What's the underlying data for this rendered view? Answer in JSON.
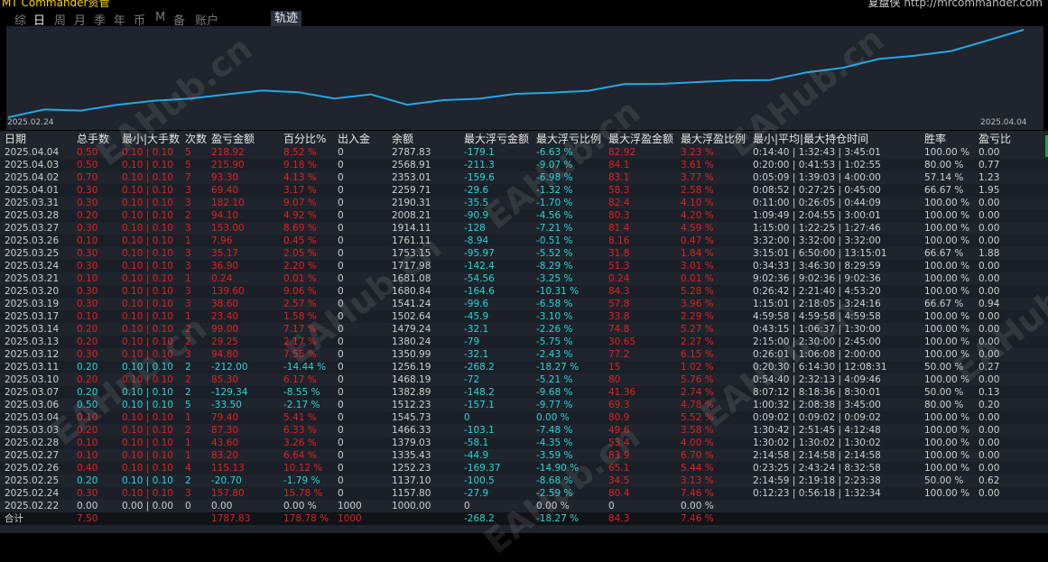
{
  "header": {
    "brand": "MT Commander资管",
    "credit_label": "复盘侠",
    "credit_url": "http://mrcommander.com"
  },
  "tabs": [
    {
      "label": "综",
      "active": false
    },
    {
      "label": "日",
      "active": true
    },
    {
      "label": "周",
      "active": false
    },
    {
      "label": "月",
      "active": false
    },
    {
      "label": "季",
      "active": false
    },
    {
      "label": "年",
      "active": false
    },
    {
      "label": "币",
      "active": false
    },
    {
      "label": "M",
      "active": false
    },
    {
      "label": "备",
      "active": false
    },
    {
      "label": "账户",
      "active": false
    }
  ],
  "view_button": "轨迹",
  "watermark_text": "EAHub.cn",
  "chart_data": {
    "type": "line",
    "x_start_label": "2025.02.24",
    "x_end_label": "2025.04.04",
    "x": [
      "2025.02.24",
      "2025.02.25",
      "2025.02.26",
      "2025.02.27",
      "2025.02.28",
      "2025.03.03",
      "2025.03.04",
      "2025.03.06",
      "2025.03.07",
      "2025.03.10",
      "2025.03.11",
      "2025.03.12",
      "2025.03.13",
      "2025.03.14",
      "2025.03.17",
      "2025.03.19",
      "2025.03.20",
      "2025.03.21",
      "2025.03.24",
      "2025.03.25",
      "2025.03.26",
      "2025.03.27",
      "2025.03.28",
      "2025.03.31",
      "2025.04.01",
      "2025.04.02",
      "2025.04.03",
      "2025.04.04"
    ],
    "values": [
      1000.0,
      1157.8,
      1137.1,
      1252.23,
      1335.43,
      1379.03,
      1466.33,
      1545.73,
      1512.23,
      1382.89,
      1468.19,
      1256.19,
      1350.99,
      1380.24,
      1479.24,
      1502.64,
      1541.24,
      1680.84,
      1681.08,
      1717.98,
      1753.15,
      1761.11,
      1914.11,
      2008.21,
      2190.31,
      2259.71,
      2353.01,
      2568.91,
      2787.83
    ],
    "color": "#23a8e6",
    "grid": false
  },
  "table": {
    "columns": [
      "日期",
      "总手数",
      "最小|大手数",
      "次数",
      "盈亏金额",
      "百分比%",
      "出入金",
      "余额",
      "最大浮亏金额",
      "最大浮亏比例",
      "最大浮盈金额",
      "最大浮盈比例",
      "最小|平均|最大持仓时间",
      "胜率",
      "盈亏比"
    ],
    "rows": [
      {
        "tone": "red",
        "cells": [
          "2025.04.04",
          "0.50",
          "0.10 | 0.10",
          "5",
          "218.92",
          "8.52 %",
          "0",
          "2787.83",
          "-179.1",
          "-6.63 %",
          "82.92",
          "3.23 %",
          "0:14:40 | 1:32:43 | 3:45:01",
          "100.00 %",
          "0.00"
        ]
      },
      {
        "tone": "red",
        "cells": [
          "2025.04.03",
          "0.50",
          "0.10 | 0.10",
          "5",
          "215.90",
          "9.18 %",
          "0",
          "2568.91",
          "-211.3",
          "-9.07 %",
          "84.1",
          "3.61 %",
          "0:20:00 | 0:41:53 | 1:02:55",
          "80.00 %",
          "0.77"
        ]
      },
      {
        "tone": "red",
        "cells": [
          "2025.04.02",
          "0.70",
          "0.10 | 0.10",
          "7",
          "93.30",
          "4.13 %",
          "0",
          "2353.01",
          "-159.6",
          "-6.98 %",
          "83.1",
          "3.77 %",
          "0:05:09 | 1:39:03 | 4:00:00",
          "57.14 %",
          "1.23"
        ]
      },
      {
        "tone": "red",
        "cells": [
          "2025.04.01",
          "0.30",
          "0.10 | 0.10",
          "3",
          "69.40",
          "3.17 %",
          "0",
          "2259.71",
          "-29.6",
          "-1.32 %",
          "58.3",
          "2.58 %",
          "0:08:52 | 0:27:25 | 0:45:00",
          "66.67 %",
          "1.95"
        ]
      },
      {
        "tone": "red",
        "cells": [
          "2025.03.31",
          "0.30",
          "0.10 | 0.10",
          "3",
          "182.10",
          "9.07 %",
          "0",
          "2190.31",
          "-35.5",
          "-1.70 %",
          "82.4",
          "4.10 %",
          "0:11:00 | 0:26:05 | 0:44:09",
          "100.00 %",
          "0.00"
        ]
      },
      {
        "tone": "red",
        "cells": [
          "2025.03.28",
          "0.20",
          "0.10 | 0.10",
          "2",
          "94.10",
          "4.92 %",
          "0",
          "2008.21",
          "-90.9",
          "-4.56 %",
          "80.3",
          "4.20 %",
          "1:09:49 | 2:04:55 | 3:00:01",
          "100.00 %",
          "0.00"
        ]
      },
      {
        "tone": "red",
        "cells": [
          "2025.03.27",
          "0.30",
          "0.10 | 0.10",
          "3",
          "153.00",
          "8.69 %",
          "0",
          "1914.11",
          "-128",
          "-7.21 %",
          "81.4",
          "4.59 %",
          "1:15:00 | 1:22:25 | 1:27:46",
          "100.00 %",
          "0.00"
        ]
      },
      {
        "tone": "red",
        "cells": [
          "2025.03.26",
          "0.10",
          "0.10 | 0.10",
          "1",
          "7.96",
          "0.45 %",
          "0",
          "1761.11",
          "-8.94",
          "-0.51 %",
          "8.16",
          "0.47 %",
          "3:32:00 | 3:32:00 | 3:32:00",
          "100.00 %",
          "0.00"
        ]
      },
      {
        "tone": "red",
        "cells": [
          "2025.03.25",
          "0.30",
          "0.10 | 0.10",
          "3",
          "35.17",
          "2.05 %",
          "0",
          "1753.15",
          "-95.97",
          "-5.52 %",
          "31.8",
          "1.84 %",
          "3:15:01 | 6:50:00 | 13:15:01",
          "66.67 %",
          "1.88"
        ]
      },
      {
        "tone": "red",
        "cells": [
          "2025.03.24",
          "0.30",
          "0.10 | 0.10",
          "3",
          "36.90",
          "2.20 %",
          "0",
          "1717.98",
          "-142.4",
          "-8.29 %",
          "51.3",
          "3.01 %",
          "0:34:33 | 3:46:30 | 8:29:59",
          "100.00 %",
          "0.00"
        ]
      },
      {
        "tone": "red",
        "cells": [
          "2025.03.21",
          "0.10",
          "0.10 | 0.10",
          "1",
          "0.24",
          "0.01 %",
          "0",
          "1681.08",
          "-54.56",
          "-3.25 %",
          "0.24",
          "0.01 %",
          "9:02:36 | 9:02:36 | 9:02:36",
          "100.00 %",
          "0.00"
        ]
      },
      {
        "tone": "red",
        "cells": [
          "2025.03.20",
          "0.30",
          "0.10 | 0.10",
          "3",
          "139.60",
          "9.06 %",
          "0",
          "1680.84",
          "-164.6",
          "-10.31 %",
          "84.3",
          "5.28 %",
          "0:26:42 | 2:21:40 | 4:53:20",
          "100.00 %",
          "0.00"
        ]
      },
      {
        "tone": "red",
        "cells": [
          "2025.03.19",
          "0.30",
          "0.10 | 0.10",
          "3",
          "38.60",
          "2.57 %",
          "0",
          "1541.24",
          "-99.6",
          "-6.58 %",
          "57.8",
          "3.96 %",
          "1:15:01 | 2:18:05 | 3:24:16",
          "66.67 %",
          "0.94"
        ]
      },
      {
        "tone": "red",
        "cells": [
          "2025.03.17",
          "0.10",
          "0.10 | 0.10",
          "1",
          "23.40",
          "1.58 %",
          "0",
          "1502.64",
          "-45.9",
          "-3.10 %",
          "33.8",
          "2.29 %",
          "4:59:58 | 4:59:58 | 4:59:58",
          "100.00 %",
          "0.00"
        ]
      },
      {
        "tone": "red",
        "cells": [
          "2025.03.14",
          "0.20",
          "0.10 | 0.10",
          "2",
          "99.00",
          "7.17 %",
          "0",
          "1479.24",
          "-32.1",
          "-2.26 %",
          "74.8",
          "5.27 %",
          "0:43:15 | 1:06:37 | 1:30:00",
          "100.00 %",
          "0.00"
        ]
      },
      {
        "tone": "red",
        "cells": [
          "2025.03.13",
          "0.20",
          "0.10 | 0.10",
          "2",
          "29.25",
          "2.17 %",
          "0",
          "1380.24",
          "-79",
          "-5.75 %",
          "30.65",
          "2.27 %",
          "2:15:00 | 2:30:00 | 2:45:00",
          "100.00 %",
          "0.00"
        ]
      },
      {
        "tone": "red",
        "cells": [
          "2025.03.12",
          "0.30",
          "0.10 | 0.10",
          "3",
          "94.80",
          "7.55 %",
          "0",
          "1350.99",
          "-32.1",
          "-2.43 %",
          "77.2",
          "6.15 %",
          "0:26:01 | 1:06:08 | 2:00:00",
          "100.00 %",
          "0.00"
        ]
      },
      {
        "tone": "cyan",
        "cells": [
          "2025.03.11",
          "0.20",
          "0.10 | 0.10",
          "2",
          "-212.00",
          "-14.44 %",
          "0",
          "1256.19",
          "-268.2",
          "-18.27 %",
          "15",
          "1.02 %",
          "0:20:30 | 6:14:30 | 12:08:31",
          "50.00 %",
          "0.27"
        ]
      },
      {
        "tone": "red",
        "cells": [
          "2025.03.10",
          "0.20",
          "0.10 | 0.10",
          "2",
          "85.30",
          "6.17 %",
          "0",
          "1468.19",
          "-72",
          "-5.21 %",
          "80",
          "5.76 %",
          "0:54:40 | 2:32:13 | 4:09:46",
          "100.00 %",
          "0.00"
        ]
      },
      {
        "tone": "cyan",
        "cells": [
          "2025.03.07",
          "0.20",
          "0.10 | 0.10",
          "2",
          "-129.34",
          "-8.55 %",
          "0",
          "1382.89",
          "-148.2",
          "-9.68 %",
          "41.36",
          "2.74 %",
          "8:07:12 | 8:18:36 | 8:30:01",
          "50.00 %",
          "0.13"
        ]
      },
      {
        "tone": "cyan",
        "cells": [
          "2025.03.06",
          "0.50",
          "0.10 | 0.10",
          "5",
          "-33.50",
          "-2.17 %",
          "0",
          "1512.23",
          "-157.1",
          "-9.77 %",
          "69.3",
          "4.78 %",
          "1:00:32 | 2:08:38 | 3:45:00",
          "80.00 %",
          "0.20"
        ]
      },
      {
        "tone": "red",
        "cells": [
          "2025.03.04",
          "0.10",
          "0.10 | 0.10",
          "1",
          "79.40",
          "5.41 %",
          "0",
          "1545.73",
          "0",
          "0.00 %",
          "80.9",
          "5.52 %",
          "0:09:02 | 0:09:02 | 0:09:02",
          "100.00 %",
          "0.00"
        ]
      },
      {
        "tone": "red",
        "cells": [
          "2025.03.03",
          "0.20",
          "0.10 | 0.10",
          "2",
          "87.30",
          "6.33 %",
          "0",
          "1466.33",
          "-103.1",
          "-7.48 %",
          "49.6",
          "3.58 %",
          "1:30:42 | 2:51:45 | 4:12:48",
          "100.00 %",
          "0.00"
        ]
      },
      {
        "tone": "red",
        "cells": [
          "2025.02.28",
          "0.10",
          "0.10 | 0.10",
          "1",
          "43.60",
          "3.26 %",
          "0",
          "1379.03",
          "-58.1",
          "-4.35 %",
          "53.4",
          "4.00 %",
          "1:30:02 | 1:30:02 | 1:30:02",
          "100.00 %",
          "0.00"
        ]
      },
      {
        "tone": "red",
        "cells": [
          "2025.02.27",
          "0.10",
          "0.10 | 0.10",
          "1",
          "83.20",
          "6.64 %",
          "0",
          "1335.43",
          "-44.9",
          "-3.59 %",
          "83.9",
          "6.70 %",
          "2:14:58 | 2:14:58 | 2:14:58",
          "100.00 %",
          "0.00"
        ]
      },
      {
        "tone": "red",
        "cells": [
          "2025.02.26",
          "0.40",
          "0.10 | 0.10",
          "4",
          "115.13",
          "10.12 %",
          "0",
          "1252.23",
          "-169.37",
          "-14.90 %",
          "65.1",
          "5.44 %",
          "0:23:25 | 2:43:24 | 8:32:58",
          "100.00 %",
          "0.00"
        ]
      },
      {
        "tone": "cyan",
        "cells": [
          "2025.02.25",
          "0.20",
          "0.10 | 0.10",
          "2",
          "-20.70",
          "-1.79 %",
          "0",
          "1137.10",
          "-100.5",
          "-8.68 %",
          "34.5",
          "3.13 %",
          "2:14:59 | 2:19:18 | 2:23:38",
          "50.00 %",
          "0.62"
        ]
      },
      {
        "tone": "red",
        "cells": [
          "2025.02.24",
          "0.30",
          "0.10 | 0.10",
          "3",
          "157.80",
          "15.78 %",
          "0",
          "1157.80",
          "-27.9",
          "-2.59 %",
          "80.4",
          "7.46 %",
          "0:12:23 | 0:56:18 | 1:32:34",
          "100.00 %",
          "0.00"
        ]
      },
      {
        "tone": "white",
        "cells": [
          "2025.02.22",
          "0.00",
          "0.00 | 0.00",
          "0",
          "0.00",
          "0.00 %",
          "1000",
          "1000.00",
          "0",
          "0.00 %",
          "0",
          "0.00 %",
          "",
          "",
          ""
        ]
      }
    ],
    "total": [
      "合计",
      "7.50",
      "",
      "",
      "1787.83",
      "178.78 %",
      "1000",
      "",
      "-268.2",
      "-18.27 %",
      "84.3",
      "7.46 %",
      "",
      "",
      ""
    ]
  }
}
